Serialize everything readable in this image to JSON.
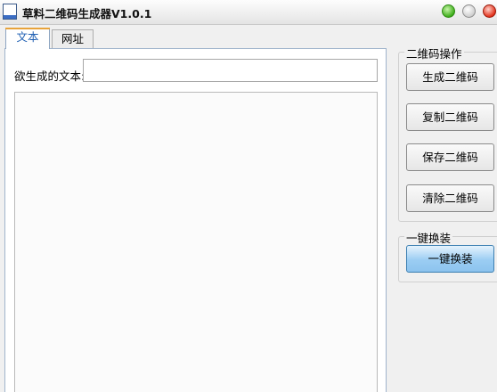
{
  "window": {
    "title": "草料二维码生成器V1.0.1",
    "app_icon_text": "草料二维码"
  },
  "tabs": [
    {
      "label": "文本",
      "active": true
    },
    {
      "label": "网址",
      "active": false
    }
  ],
  "text_panel": {
    "input_label": "欲生成的文本:",
    "input_value": "",
    "content_value": ""
  },
  "qr_operations": {
    "title": "二维码操作",
    "buttons": {
      "generate": "生成二维码",
      "copy": "复制二维码",
      "save": "保存二维码",
      "clear": "清除二维码"
    }
  },
  "skin": {
    "title": "一键换装",
    "button": "一键换装"
  },
  "colors": {
    "active_tab_text": "#1e5fb3",
    "active_tab_accent": "#e8a33a",
    "primary_button": "#9bcdf3"
  }
}
